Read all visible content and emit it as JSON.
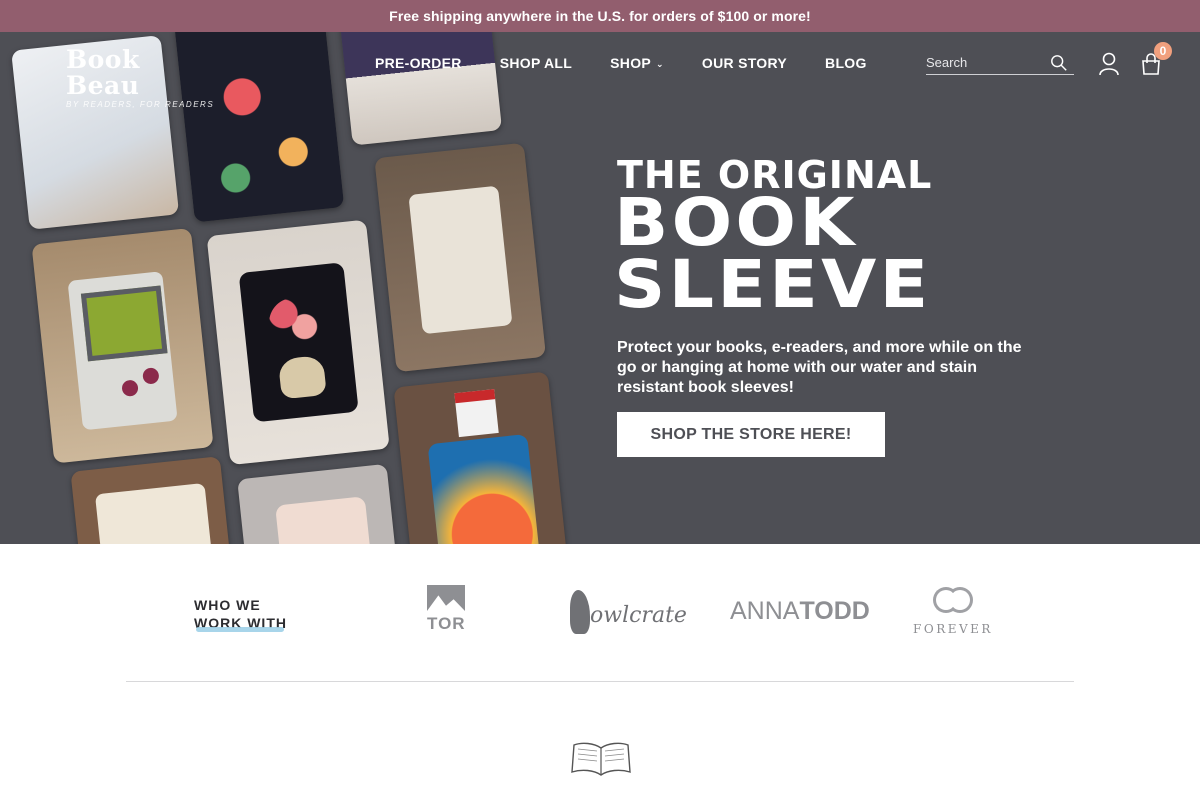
{
  "announcement": "Free shipping anywhere in the U.S. for orders of $100 or more!",
  "logo": {
    "title": "Book Beau",
    "tagline": "BY READERS, FOR READERS"
  },
  "nav": {
    "items": [
      {
        "label": "PRE-ORDER"
      },
      {
        "label": "SHOP ALL"
      },
      {
        "label": "SHOP",
        "has_dropdown": true
      },
      {
        "label": "OUR STORY"
      },
      {
        "label": "BLOG"
      }
    ]
  },
  "header": {
    "search_placeholder": "Search",
    "cart_count": "0",
    "icons": [
      "search-icon",
      "account-icon",
      "cart-icon"
    ]
  },
  "hero": {
    "kicker": "THE ORIGINAL",
    "title_line1": "BOOK",
    "title_line2": "SLEEVE",
    "description": "Protect your books, e-readers, and more while on the go or hanging at home with our water and stain resistant book sleeves!",
    "cta": "SHOP THE STORE HERE!"
  },
  "partners": {
    "heading_line1": "WHO WE",
    "heading_line2": "WORK WITH",
    "logos": {
      "tor": "TOR",
      "owlcrate": "owlcrate",
      "anna_first": "ANNA",
      "anna_last": "TODD",
      "forever": "FOREVER"
    }
  },
  "colors": {
    "announcement_bg": "#925e6e",
    "hero_bg": "#4e4f55",
    "cart_badge": "#f1a07e",
    "underline_accent": "#9ed0e8"
  }
}
